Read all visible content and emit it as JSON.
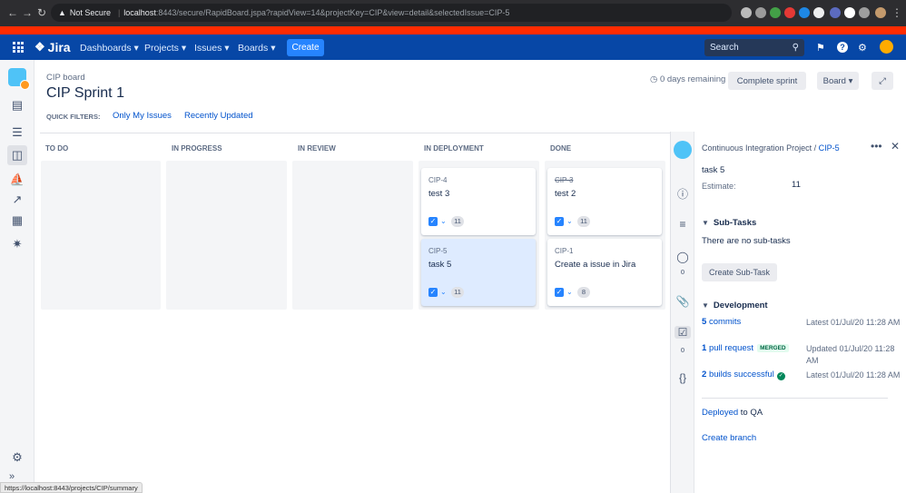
{
  "browser": {
    "security": "Not Secure",
    "url_host": "localhost",
    "url_path": ":8443/secure/RapidBoard.jspa?rapidView=14&projectKey=CIP&view=detail&selectedIssue=CIP-5",
    "status_url": "https://localhost:8443/projects/CIP/summary"
  },
  "nav": {
    "logo": "Jira",
    "items": [
      "Dashboards",
      "Projects",
      "Issues",
      "Boards"
    ],
    "create": "Create",
    "search_placeholder": "Search"
  },
  "board": {
    "breadcrumb": "CIP board",
    "title": "CIP Sprint 1",
    "remaining": "0 days remaining",
    "complete_sprint": "Complete sprint",
    "board_menu": "Board",
    "quick_filters_label": "QUICK FILTERS:",
    "quick_filters": [
      "Only My Issues",
      "Recently Updated"
    ],
    "columns": [
      "TO DO",
      "IN PROGRESS",
      "IN REVIEW",
      "IN DEPLOYMENT",
      "DONE"
    ],
    "cards": [
      {
        "key": "CIP-4",
        "summary": "test 3",
        "estimate": "11",
        "column": "IN DEPLOYMENT",
        "done": false,
        "selected": false
      },
      {
        "key": "CIP-5",
        "summary": "task 5",
        "estimate": "11",
        "column": "IN DEPLOYMENT",
        "done": false,
        "selected": true
      },
      {
        "key": "CIP-3",
        "summary": "test 2",
        "estimate": "11",
        "column": "DONE",
        "done": true,
        "selected": false
      },
      {
        "key": "CIP-1",
        "summary": "Create a issue in Jira",
        "estimate": "8",
        "column": "DONE",
        "done": false,
        "selected": false
      }
    ]
  },
  "detail": {
    "project": "Continuous Integration Project",
    "separator": "/",
    "issue_key": "CIP-5",
    "summary": "task 5",
    "estimate_label": "Estimate:",
    "estimate_value": "11",
    "comment_count": "0",
    "checklist_count": "0",
    "subtasks_title": "Sub-Tasks",
    "subtasks_empty": "There are no sub-tasks",
    "create_subtask": "Create Sub-Task",
    "development_title": "Development",
    "dev": {
      "commits_count": "5",
      "commits_label": "commits",
      "commits_date": "Latest 01/Jul/20 11:28 AM",
      "pr_count": "1",
      "pr_label": "pull request",
      "pr_badge": "MERGED",
      "pr_date": "Updated 01/Jul/20 11:28 AM",
      "builds_count": "2",
      "builds_label": "builds successful",
      "builds_date": "Latest 01/Jul/20 11:28 AM",
      "deployed_label": "Deployed",
      "deployed_to": "to QA",
      "create_branch": "Create branch"
    }
  },
  "colors": {
    "nav_bg": "#0747a6",
    "accent": "#0052cc",
    "red_banner": "#ff2b00",
    "selected_card": "#deebff"
  }
}
